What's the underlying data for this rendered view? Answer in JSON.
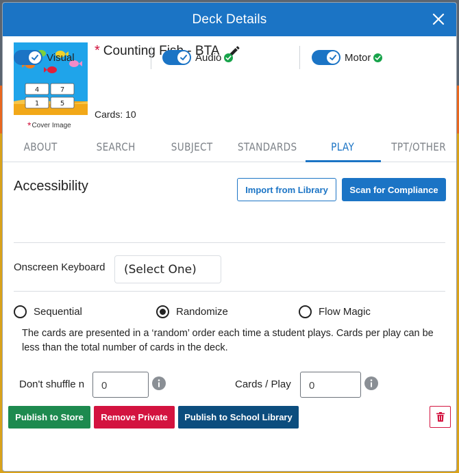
{
  "modal": {
    "title": "Deck Details",
    "close_icon": "close-icon"
  },
  "deck": {
    "required_mark": "*",
    "title": "Counting Fish - BTA",
    "cards_text": "Cards: 10",
    "cover_caption": "Cover Image",
    "cover_numbers": [
      "4",
      "7",
      "1",
      "5"
    ]
  },
  "tabs": [
    {
      "label": "ABOUT",
      "active": false
    },
    {
      "label": "SEARCH",
      "active": false
    },
    {
      "label": "SUBJECT",
      "active": false
    },
    {
      "label": "STANDARDS",
      "active": false
    },
    {
      "label": "PLAY",
      "active": true
    },
    {
      "label": "TPT/OTHER",
      "active": false
    }
  ],
  "accessibility": {
    "title": "Accessibility",
    "import_label": "Import from Library",
    "scan_label": "Scan for Compliance",
    "toggles": [
      {
        "label": "Visual",
        "on": true,
        "compliant": false
      },
      {
        "label": "Audio",
        "on": true,
        "compliant": true
      },
      {
        "label": "Motor",
        "on": true,
        "compliant": true
      }
    ]
  },
  "keyboard": {
    "label": "Onscreen Keyboard",
    "value": "(Select One)"
  },
  "order": {
    "options": [
      {
        "label": "Sequential",
        "checked": false
      },
      {
        "label": "Randomize",
        "checked": true
      },
      {
        "label": "Flow Magic",
        "checked": false
      }
    ],
    "description": "The cards are presented in a ‘random’ order each time a student plays. Cards per play can be less than the total number of cards in the deck."
  },
  "shuffle": {
    "label": "Don't shuffle n",
    "value": "0"
  },
  "cards_per_play": {
    "label": "Cards / Play",
    "value": "0"
  },
  "actions": {
    "publish_store": "Publish to Store",
    "remove_private": "Remove Private",
    "publish_school": "Publish to School Library"
  },
  "colors": {
    "primary": "#1b74c5",
    "success": "#1d8a4f",
    "danger": "#d3133f",
    "navy": "#0c4d7e",
    "check_green": "#17a34a"
  }
}
